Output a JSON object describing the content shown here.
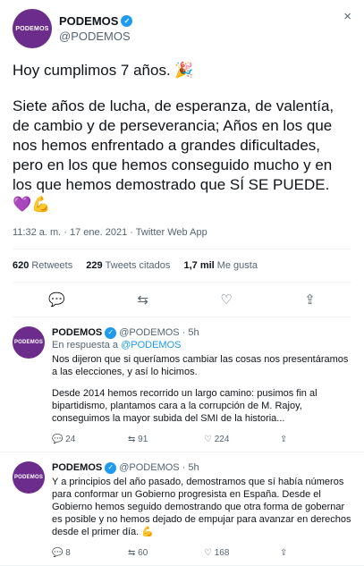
{
  "tweet": {
    "avatar_text": "PODEMOS",
    "name": "PODEMOS",
    "handle": "@PODEMOS",
    "close_glyph": "×",
    "line1": "Hoy cumplimos 7 años.",
    "emoji1": "🎉",
    "line2": "Siete años de lucha, de esperanza, de valentía, de cambio y de perseverancia; Años en los que nos hemos enfrentado a grandes dificultades, pero en los que hemos conseguido mucho y en los que hemos demostrado que SÍ SE PUEDE.",
    "emoji2": "💜💪",
    "meta": "11:32 a. m. · 17 ene. 2021 · Twitter Web App",
    "retweets_num": "620",
    "retweets_label": "Retweets",
    "quotes_num": "229",
    "quotes_label": "Tweets citados",
    "likes_num": "1,7 mil",
    "likes_label": "Me gusta"
  },
  "replies": [
    {
      "avatar_text": "PODEMOS",
      "name": "PODEMOS",
      "handle": "@PODEMOS",
      "time": "· 5h",
      "in_reply_label": "En respuesta a",
      "in_reply_handle": "@PODEMOS",
      "p1": "Nos dijeron que si queríamos cambiar las cosas nos presentáramos a las elecciones, y así lo hicimos.",
      "p2": "Desde 2014 hemos recorrido un largo camino: pusimos fin al bipartidismo, plantamos cara a la corrupción de M. Rajoy, conseguimos la mayor subida del SMI de la historia...",
      "replies": "24",
      "retweets": "91",
      "likes": "224"
    },
    {
      "avatar_text": "PODEMOS",
      "name": "PODEMOS",
      "handle": "@PODEMOS",
      "time": "· 5h",
      "p1": "Y a principios del año pasado, demostramos que sí había números para conformar un Gobierno progresista en España. Desde el Gobierno hemos seguido demostrando que otra forma de gobernar es posible y no hemos dejado de empujar para avanzar en derechos desde el primer día.",
      "emoji": "💪",
      "replies": "8",
      "retweets": "60",
      "likes": "168"
    }
  ],
  "icons": {
    "reply": "💬",
    "retweet": "⇆",
    "like": "♡",
    "share": "⇪"
  },
  "colors": {
    "accent": "#1d9bf0",
    "avatar": "#6b2c8c"
  }
}
